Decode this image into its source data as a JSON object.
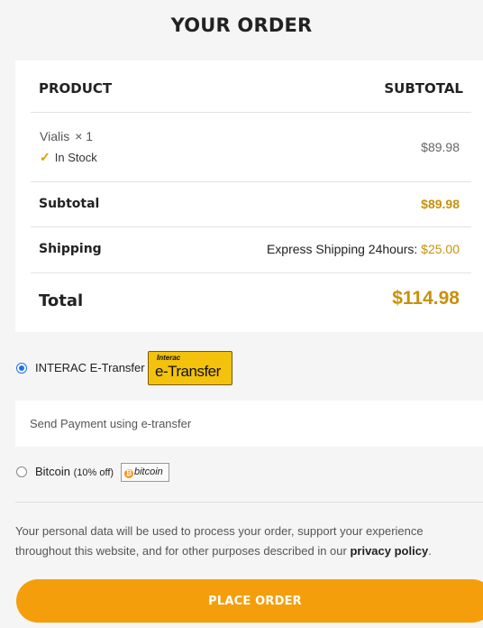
{
  "title": "YOUR ORDER",
  "table": {
    "head_product": "PRODUCT",
    "head_subtotal": "SUBTOTAL",
    "item": {
      "name": "Vialis",
      "qty": "× 1",
      "stock": "In Stock",
      "price": "$89.98"
    },
    "subtotal_label": "Subtotal",
    "subtotal_value": "$89.98",
    "shipping_label": "Shipping",
    "shipping_method": "Express Shipping 24hours:",
    "shipping_value": "$25.00",
    "total_label": "Total",
    "total_value": "$114.98"
  },
  "payment": {
    "interac_label": "INTERAC E-Transfer",
    "interac_logo_small": "Interac",
    "interac_logo_big": "e-Transfer",
    "interac_selected": true,
    "interac_desc": "Send Payment using e-transfer",
    "bitcoin_label": "Bitcoin",
    "bitcoin_note": "(10% off)",
    "bitcoin_logo_text": "bitcoin",
    "bitcoin_selected": false
  },
  "privacy": {
    "text": "Your personal data will be used to process your order, support your experience throughout this website, and for other purposes described in our",
    "link": "privacy policy",
    "end": "."
  },
  "place_order_label": "PLACE ORDER",
  "colors": {
    "accent": "#f59e0b",
    "price_gold": "#c8910c",
    "radio_blue": "#1a73e8"
  }
}
